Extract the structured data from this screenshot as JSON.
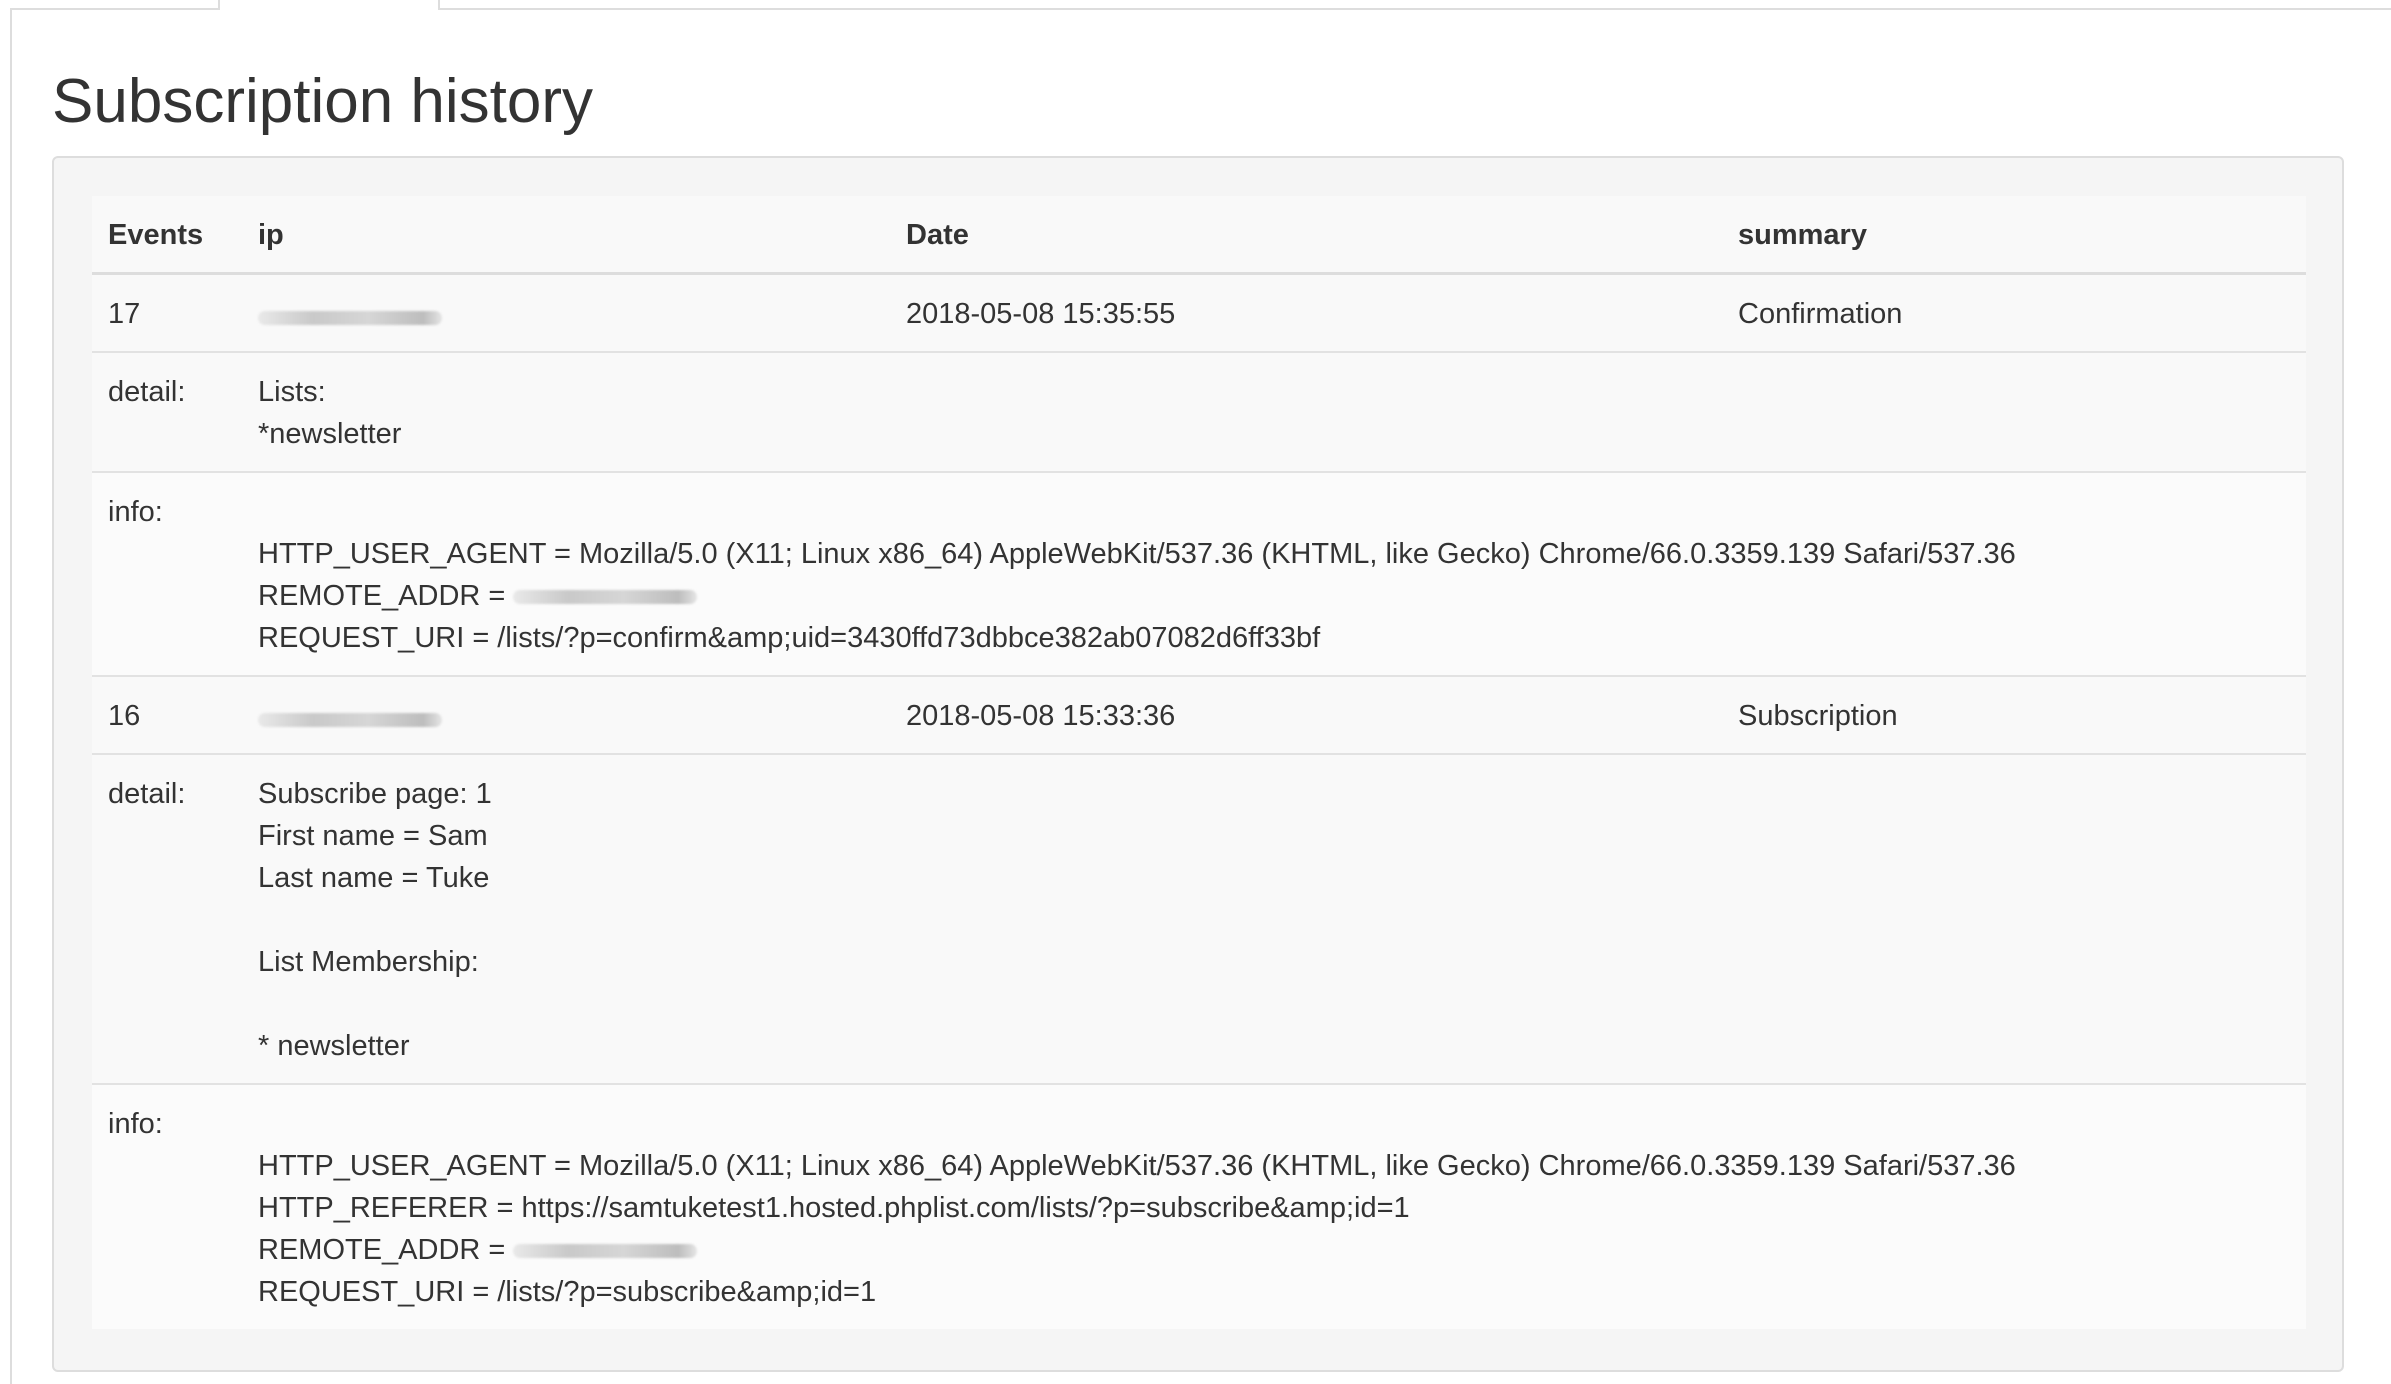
{
  "page": {
    "title": "Subscription history"
  },
  "table": {
    "headers": {
      "events": "Events",
      "ip": "ip",
      "date": "Date",
      "summary": "summary"
    },
    "entries": [
      {
        "event": "17",
        "date": "2018-05-08 15:35:55",
        "summary": "Confirmation",
        "detail_label": "detail:",
        "detail_lines": [
          "Lists:",
          "*newsletter"
        ],
        "info_label": "info:",
        "info_user_agent": "HTTP_USER_AGENT = Mozilla/5.0 (X11; Linux x86_64) AppleWebKit/537.36 (KHTML, like Gecko) Chrome/66.0.3359.139 Safari/537.36",
        "info_remote_addr_label": "REMOTE_ADDR =",
        "info_request_uri": "REQUEST_URI = /lists/?p=confirm&amp;uid=3430ffd73dbbce382ab07082d6ff33bf"
      },
      {
        "event": "16",
        "date": "2018-05-08 15:33:36",
        "summary": "Subscription",
        "detail_label": "detail:",
        "detail_lines": [
          "Subscribe page: 1",
          "First name = Sam",
          "Last name = Tuke",
          "",
          "List Membership:",
          "",
          "* newsletter"
        ],
        "info_label": "info:",
        "info_user_agent": "HTTP_USER_AGENT = Mozilla/5.0 (X11; Linux x86_64) AppleWebKit/537.36 (KHTML, like Gecko) Chrome/66.0.3359.139 Safari/537.36",
        "info_referer": "HTTP_REFERER = https://samtuketest1.hosted.phplist.com/lists/?p=subscribe&amp;id=1",
        "info_remote_addr_label": "REMOTE_ADDR =",
        "info_request_uri": "REQUEST_URI = /lists/?p=subscribe&amp;id=1"
      }
    ]
  }
}
